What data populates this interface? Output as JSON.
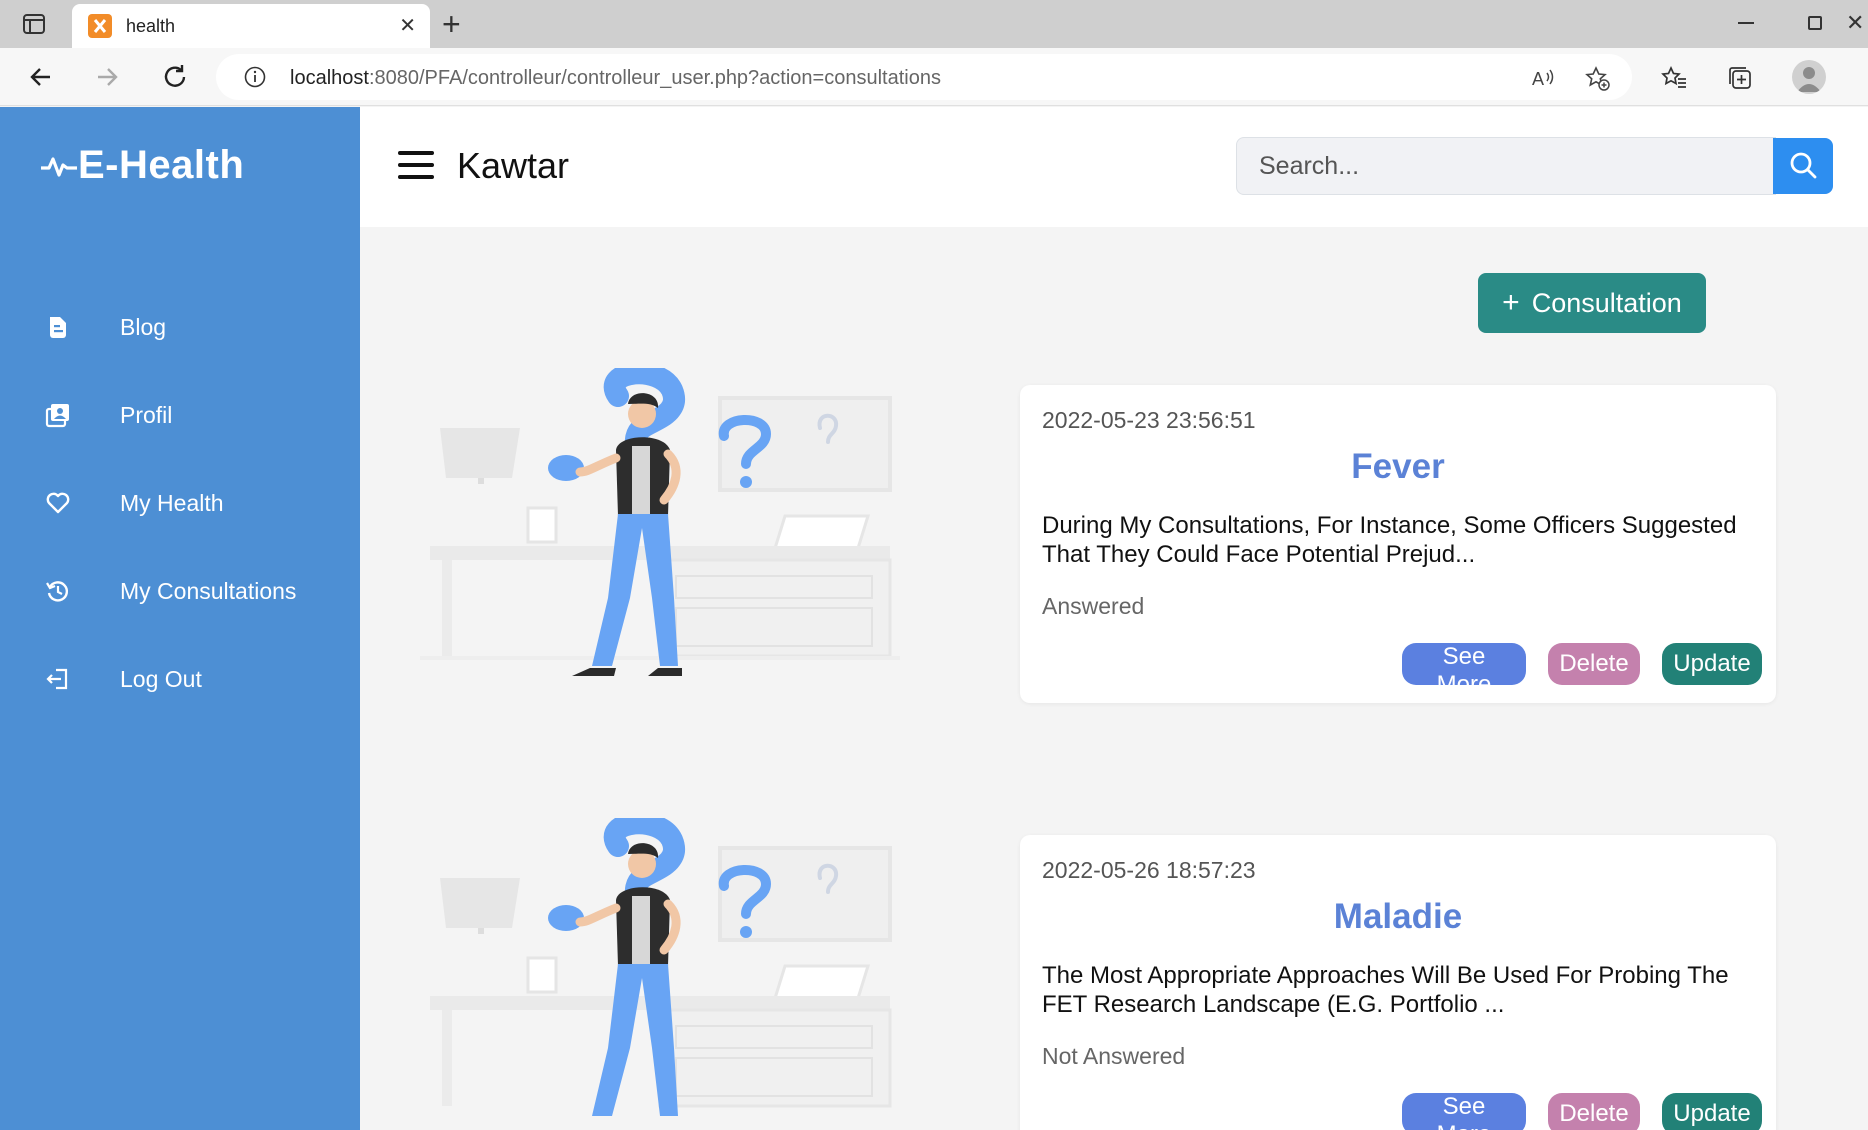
{
  "browser": {
    "tab_title": "health",
    "url_host": "localhost",
    "url_rest": ":8080/PFA/controlleur/controlleur_user.php?action=consultations"
  },
  "sidebar": {
    "brand": "E-Health",
    "items": [
      {
        "label": "Blog",
        "icon": "blog-icon"
      },
      {
        "label": "Profil",
        "icon": "profile-card-icon"
      },
      {
        "label": "My Health",
        "icon": "heart-icon"
      },
      {
        "label": "My Consultations",
        "icon": "history-icon"
      },
      {
        "label": "Log Out",
        "icon": "logout-icon"
      }
    ]
  },
  "header": {
    "user_name": "Kawtar",
    "search_placeholder": "Search..."
  },
  "main": {
    "add_label": "Consultation",
    "consultations": [
      {
        "date": "2022-05-23 23:56:51",
        "title": "Fever",
        "description": "During My Consultations, For Instance, Some Officers Suggested That They Could Face Potential Prejud...",
        "status": "Answered",
        "see_more": "See More",
        "delete": "Delete",
        "update": "Update"
      },
      {
        "date": "2022-05-26 18:57:23",
        "title": "Maladie",
        "description": "The Most Appropriate Approaches Will Be Used For Probing The FET Research Landscape (E.G. Portfolio ...",
        "status": "Not Answered",
        "see_more": "See More",
        "delete": "Delete",
        "update": "Update"
      }
    ]
  },
  "colors": {
    "sidebar": "#4d8fd4",
    "accent_teal": "#2a8b86",
    "title_blue": "#5b82d6",
    "see_more": "#5b80e0",
    "delete": "#c481ad",
    "update": "#228177",
    "search_button": "#2d8ef0"
  }
}
